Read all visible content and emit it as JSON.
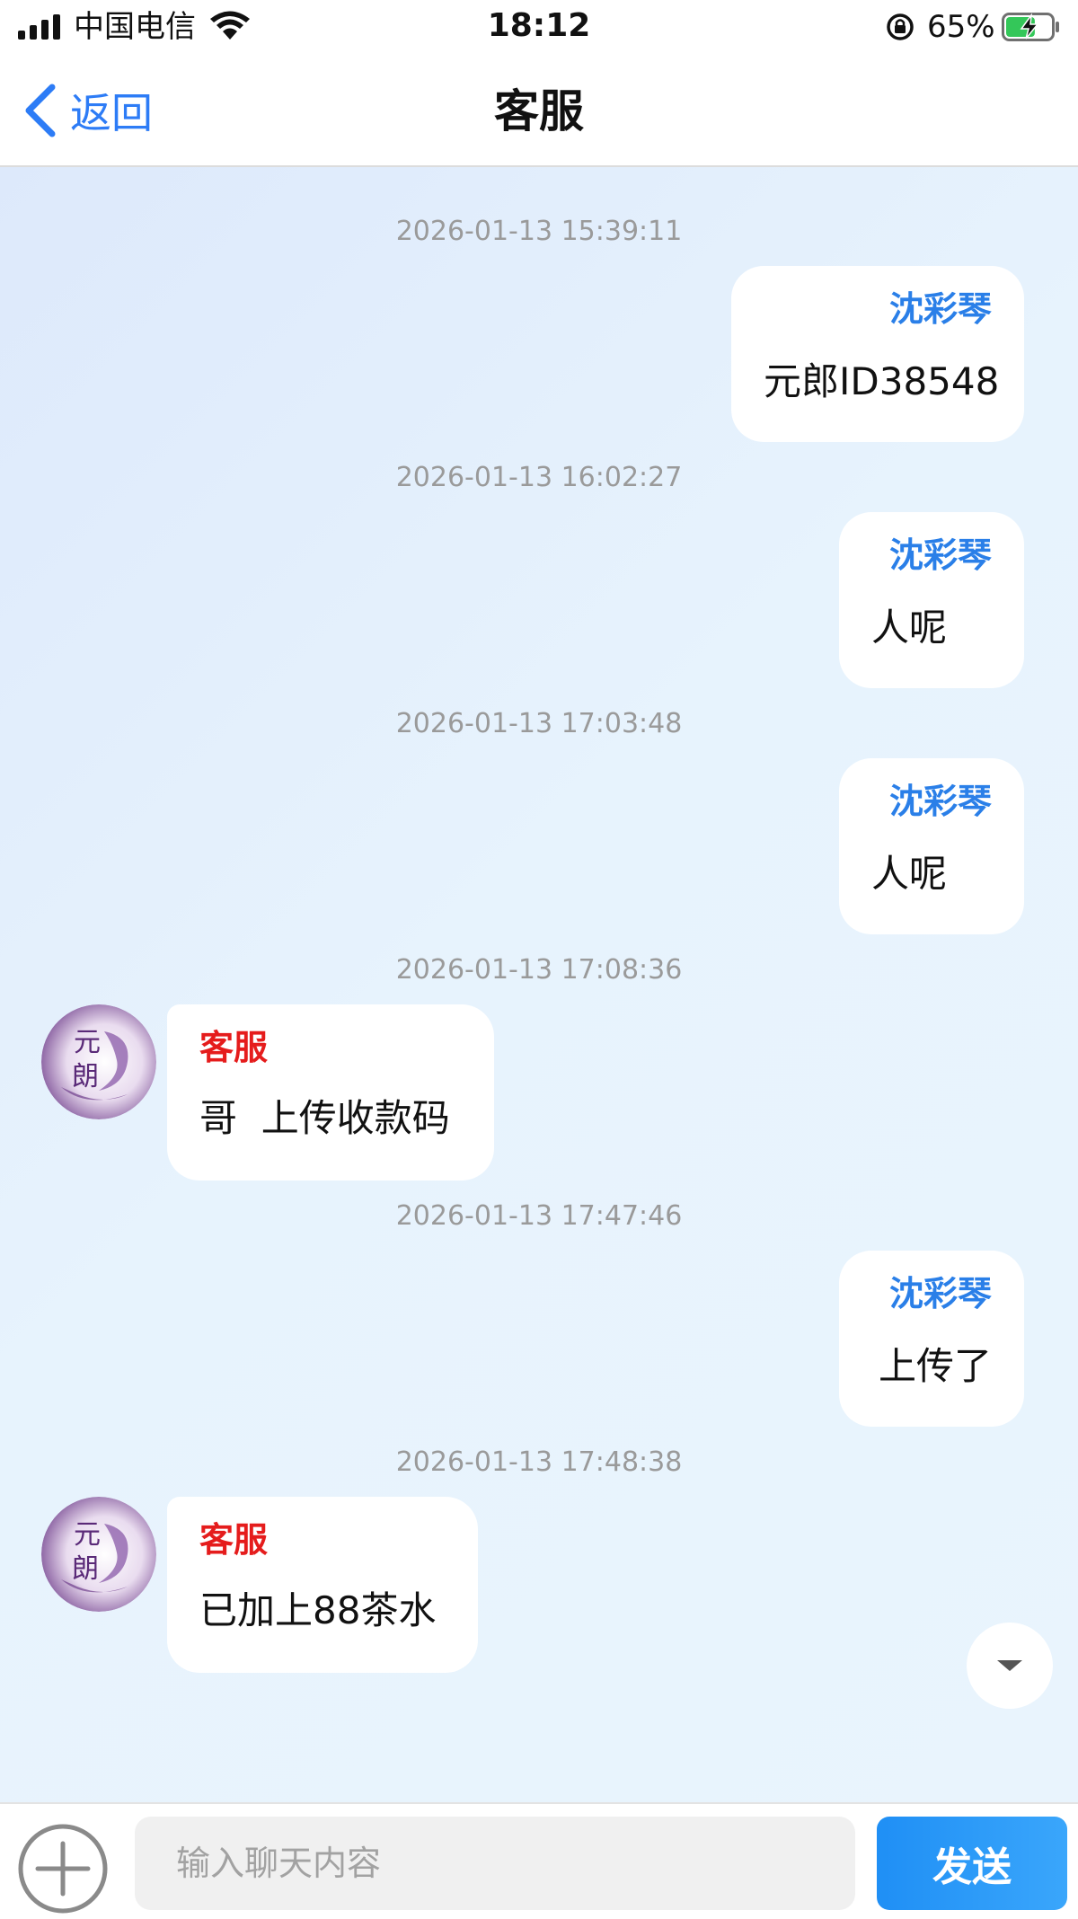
{
  "status_bar": {
    "carrier": "中国电信",
    "time": "18:12",
    "battery_percent": "65%",
    "battery_level": 0.65,
    "icons": [
      "signal-icon",
      "wifi-icon",
      "orientation-lock-icon",
      "battery-charging-icon"
    ]
  },
  "nav": {
    "back_label": "返回",
    "title": "客服"
  },
  "messages": [
    {
      "timestamp": "2026-01-13 15:39:11",
      "side": "mine",
      "sender": "沈彩琴",
      "text": "元郎ID38548"
    },
    {
      "timestamp": "2026-01-13 16:02:27",
      "side": "mine",
      "sender": "沈彩琴",
      "text": "人呢"
    },
    {
      "timestamp": "2026-01-13 17:03:48",
      "side": "mine",
      "sender": "沈彩琴",
      "text": "人呢"
    },
    {
      "timestamp": "2026-01-13 17:08:36",
      "side": "theirs",
      "sender": "客服",
      "text": "哥  上传收款码"
    },
    {
      "timestamp": "2026-01-13 17:47:46",
      "side": "mine",
      "sender": "沈彩琴",
      "text": "上传了"
    },
    {
      "timestamp": "2026-01-13 17:48:38",
      "side": "theirs",
      "sender": "客服",
      "text": "已加上88茶水"
    }
  ],
  "avatar": {
    "text_top": "元",
    "text_bottom": "朗"
  },
  "input": {
    "placeholder": "输入聊天内容",
    "value": "",
    "send_label": "发送"
  },
  "colors": {
    "accent": "#2d7cf6",
    "sender_me": "#2a7fe8",
    "sender_cs": "#e51c1c",
    "send_button": "#1f8ff5"
  }
}
